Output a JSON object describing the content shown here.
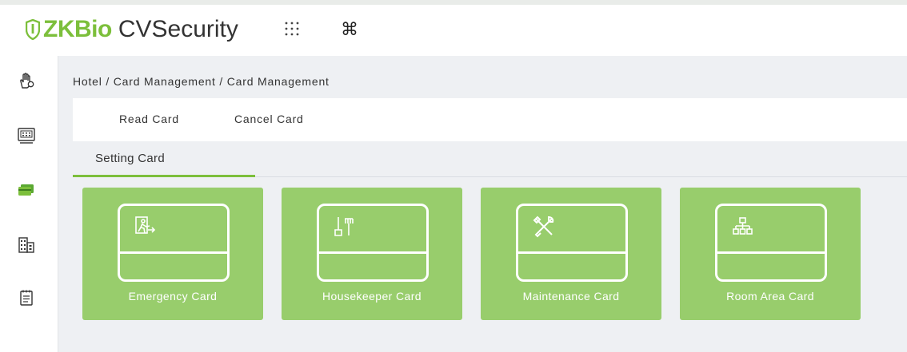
{
  "app": {
    "logo_brand": "ZKBio",
    "logo_product": "CVSecurity",
    "accent_color": "#7cbf3b",
    "card_color": "#98cd6c"
  },
  "header": {
    "icons": [
      "apps-grid-icon",
      "command-icon"
    ]
  },
  "sidebar": {
    "items": [
      {
        "icon": "hand-icon"
      },
      {
        "icon": "terminal-icon"
      },
      {
        "icon": "card-icon"
      },
      {
        "icon": "building-icon"
      },
      {
        "icon": "notepad-icon"
      }
    ]
  },
  "breadcrumb": "Hotel / Card Management / Card Management",
  "toolbar": {
    "read_card": "Read Card",
    "cancel_card": "Cancel Card"
  },
  "tabs": [
    {
      "label": "Setting Card",
      "active": true
    }
  ],
  "cards": [
    {
      "label": "Emergency Card",
      "icon": "emergency-exit-icon"
    },
    {
      "label": "Housekeeper Card",
      "icon": "cleaning-tools-icon"
    },
    {
      "label": "Maintenance Card",
      "icon": "tools-icon"
    },
    {
      "label": "Room Area Card",
      "icon": "hierarchy-icon"
    }
  ]
}
